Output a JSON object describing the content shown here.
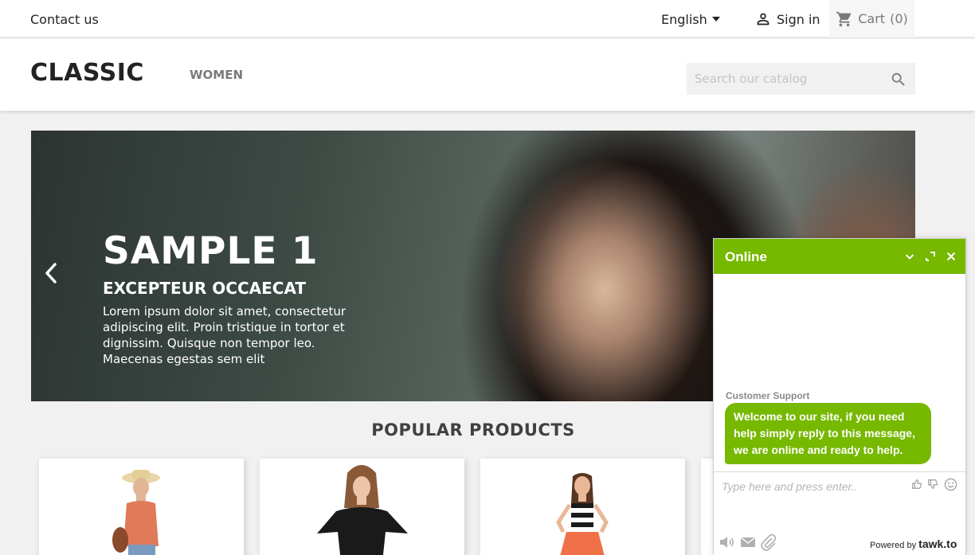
{
  "topnav": {
    "contact": "Contact us",
    "language": "English",
    "signin": "Sign in",
    "cart": "Cart",
    "cart_count": "(0)"
  },
  "header": {
    "logo": "CLASSIC",
    "menu": [
      "WOMEN"
    ],
    "search_placeholder": "Search our catalog"
  },
  "slider": {
    "title": "SAMPLE 1",
    "subtitle": "EXCEPTEUR OCCAECAT",
    "text": "Lorem ipsum dolor sit amet, consectetur adipiscing elit. Proin tristique in tortor et dignissim. Quisque non tempor leo. Maecenas egestas sem elit"
  },
  "products": {
    "title": "POPULAR PRODUCTS"
  },
  "chat": {
    "status": "Online",
    "agent": "Customer Support",
    "message": "Welcome to our site, if you need help simply reply to this message, we are online and ready to help.",
    "input_placeholder": "Type here and press enter..",
    "powered_by": "Powered by",
    "brand": "tawk.to",
    "accent_color": "#77b800"
  }
}
